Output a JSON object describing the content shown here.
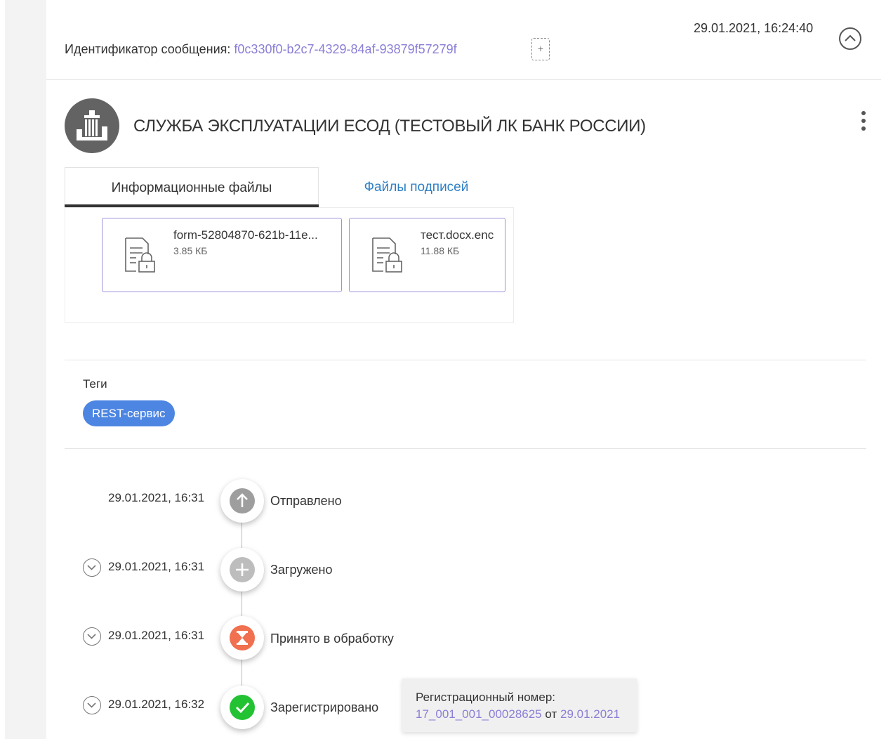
{
  "message": {
    "id_label": "Идентификатор сообщения:",
    "id_value": "f0c330f0-b2c7-4329-84af-93879f57279f",
    "timestamp": "29.01.2021, 16:24:40"
  },
  "sender": {
    "name": "СЛУЖБА ЭКСПЛУАТАЦИИ ЕСОД (ТЕСТОВЫЙ ЛК БАНК РОССИИ)"
  },
  "tabs": [
    {
      "label": "Информационные файлы",
      "active": true
    },
    {
      "label": "Файлы подписей",
      "active": false
    }
  ],
  "files": [
    {
      "name": "form-52804870-621b-11e...",
      "size": "3.85 КБ"
    },
    {
      "name": "тест.docx.enc",
      "size": "11.88 КБ"
    }
  ],
  "tags": {
    "title": "Теги",
    "items": [
      "REST-сервис"
    ]
  },
  "timeline": [
    {
      "time": "29.01.2021, 16:31",
      "status": "Отправлено",
      "icon": "arrow-up-icon",
      "color": "#9e9e9e"
    },
    {
      "time": "29.01.2021, 16:31",
      "status": "Загружено",
      "icon": "plus-icon",
      "color": "#bdbdbd"
    },
    {
      "time": "29.01.2021, 16:31",
      "status": "Принято в обработку",
      "icon": "hourglass-icon",
      "color": "#f07050"
    },
    {
      "time": "29.01.2021, 16:32",
      "status": "Зарегистрировано",
      "icon": "check-icon",
      "color": "#22c233"
    }
  ],
  "registration": {
    "title": "Регистрационный номер:",
    "number": "17_001_001_00028625",
    "from_word": "от",
    "date": "29.01.2021"
  },
  "colors": {
    "link": "#8a7fd6",
    "tab_link": "#2e7fc4",
    "tag": "#4d86e2",
    "file_border": "#9b93d8"
  }
}
